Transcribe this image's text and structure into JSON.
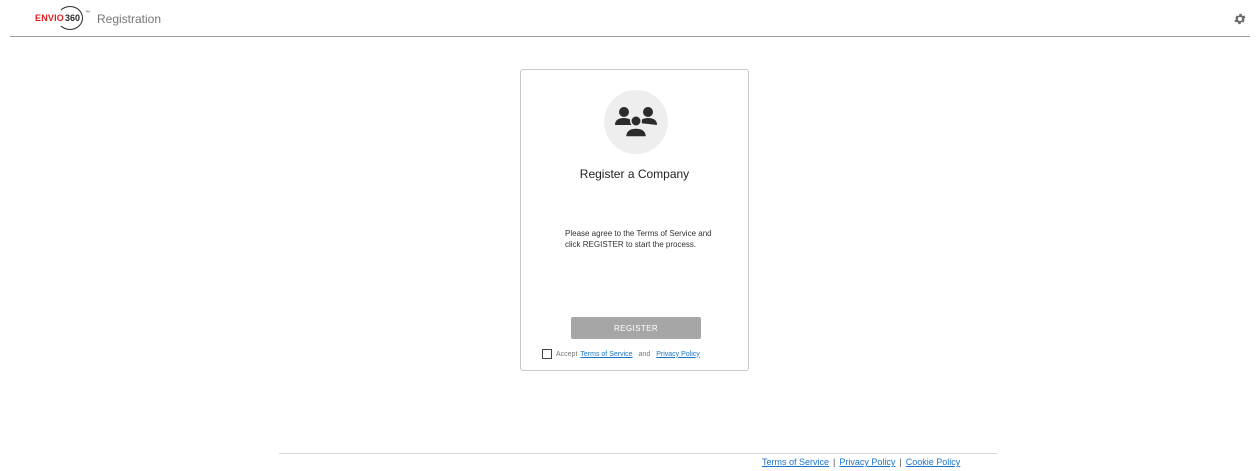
{
  "header": {
    "logo": {
      "brand_red": "ENVIO",
      "brand_number": "360",
      "tm": "™"
    },
    "title": "Registration",
    "settings_icon": "gear-icon"
  },
  "card": {
    "icon": "group-users-icon",
    "title": "Register a Company",
    "description": "Please agree to the Terms of Service and click REGISTER to start the process.",
    "register_label": "REGISTER",
    "accept": {
      "checked": false,
      "prefix": "Accept",
      "terms_link": "Terms of Service",
      "and": "and",
      "privacy_link": "Privacy Policy"
    }
  },
  "footer": {
    "links": [
      "Terms of Service",
      "Privacy Policy",
      "Cookie Policy"
    ],
    "separator": "|"
  },
  "colors": {
    "brand_red": "#e02020",
    "link_blue": "#1a73c9",
    "button_disabled": "#a6a6a6",
    "icon_dark": "#2b2b2b",
    "icon_circle_bg": "#eeeeee"
  }
}
